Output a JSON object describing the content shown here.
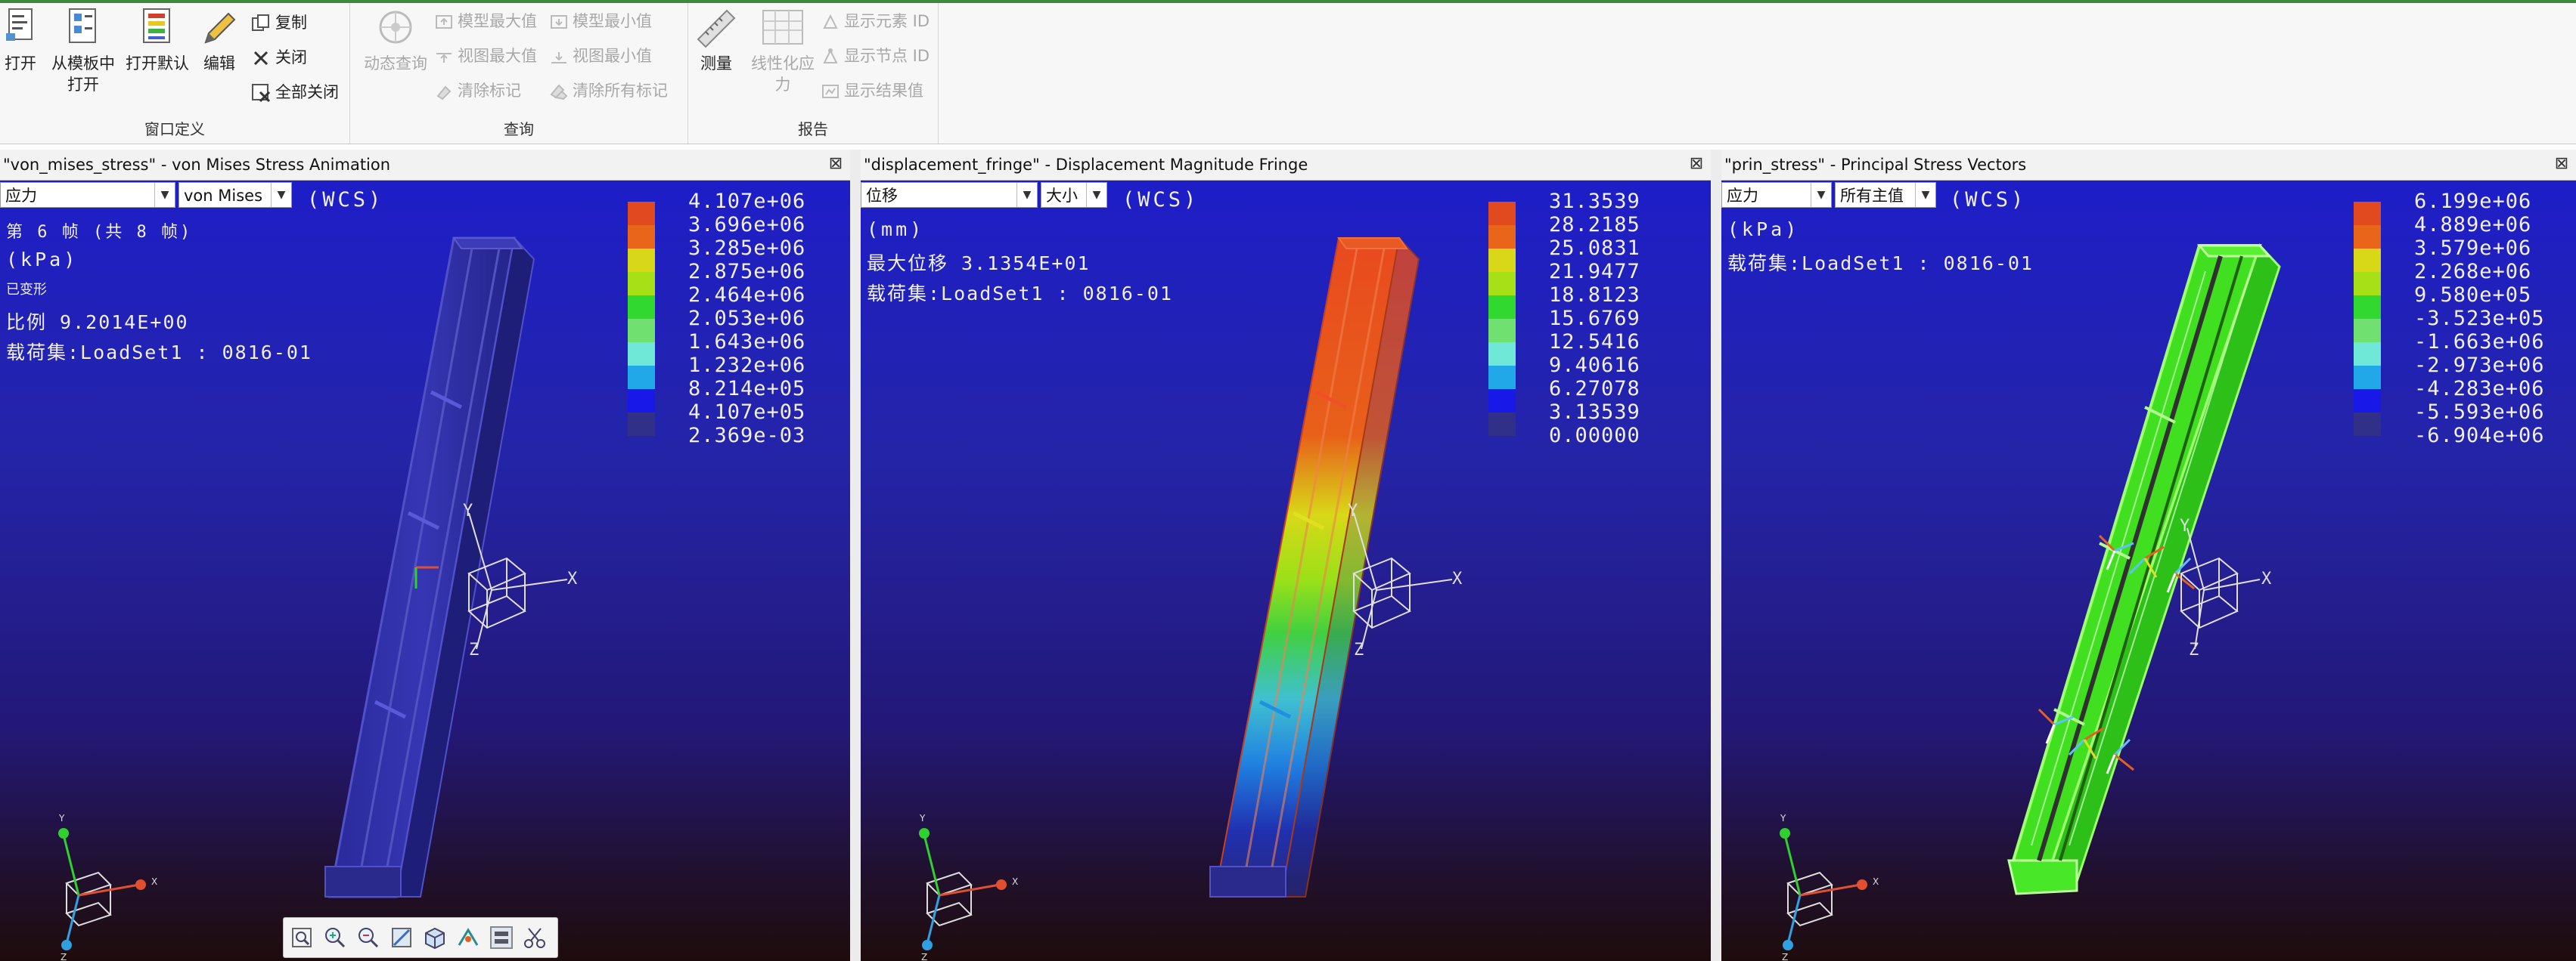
{
  "ribbon": {
    "groups": [
      {
        "label": "窗口定义",
        "buttons": [
          {
            "label_lines": [
              "打开"
            ],
            "icon": "open-file-icon"
          },
          {
            "label_lines": [
              "从模板中",
              "打开"
            ],
            "icon": "open-template-icon"
          },
          {
            "label_lines": [
              "打开默认"
            ],
            "icon": "open-default-icon"
          },
          {
            "label_lines": [
              "编辑"
            ],
            "icon": "pencil-edit-icon"
          }
        ],
        "small_buttons": [
          {
            "label": "复制",
            "icon": "copy-icon"
          },
          {
            "label": "关闭",
            "icon": "close-x-icon"
          },
          {
            "label": "全部关闭",
            "icon": "close-all-icon"
          }
        ]
      },
      {
        "label": "查询",
        "buttons": [
          {
            "label_lines": [
              "动态查询"
            ],
            "icon": "dynamic-query-icon"
          }
        ],
        "small_buttons": [
          {
            "label": "模型最大值",
            "icon": "model-max-icon"
          },
          {
            "label": "视图最大值",
            "icon": "view-max-icon"
          },
          {
            "label": "清除标记",
            "icon": "clear-marker-icon"
          },
          {
            "label": "模型最小值",
            "icon": "model-min-icon"
          },
          {
            "label": "视图最小值",
            "icon": "view-min-icon"
          },
          {
            "label": "清除所有标记",
            "icon": "clear-all-markers-icon"
          }
        ]
      },
      {
        "label": "报告",
        "buttons": [
          {
            "label_lines": [
              "测量"
            ],
            "icon": "measure-ruler-icon"
          },
          {
            "label_lines": [
              "线性化应",
              "力"
            ],
            "icon": "linearize-stress-icon"
          }
        ],
        "small_buttons": [
          {
            "label": "显示元素 ID",
            "icon": "element-id-icon"
          },
          {
            "label": "显示节点 ID",
            "icon": "node-id-icon"
          },
          {
            "label": "显示结果值",
            "icon": "result-value-icon"
          }
        ]
      }
    ]
  },
  "panes": [
    {
      "title": "\"von_mises_stress\" - von Mises Stress Animation",
      "select1": "应力",
      "select2": "von Mises",
      "wcs": "(WCS)",
      "info": [
        "第 6 帧 (共 8 帧)",
        "(kPa)",
        "已变形",
        "比例  9.2014E+00",
        "载荷集:LoadSet1 : 0816-01"
      ],
      "legend_colors": [
        "#e04a1e",
        "#e8651a",
        "#d8d818",
        "#a8e018",
        "#30d830",
        "#70e070",
        "#70e8d8",
        "#20a8e8",
        "#1818e8",
        "#303088"
      ],
      "legend_values": [
        "4.107e+06",
        "3.696e+06",
        "3.285e+06",
        "2.875e+06",
        "2.464e+06",
        "2.053e+06",
        "1.643e+06",
        "1.232e+06",
        "8.214e+05",
        "4.107e+05",
        "2.369e-03"
      ],
      "model": "blue"
    },
    {
      "title": "\"displacement_fringe\" - Displacement Magnitude Fringe",
      "select1": "位移",
      "select2": "大小",
      "wcs": "(WCS)",
      "info": [
        "(mm)",
        "最大位移  3.1354E+01",
        "载荷集:LoadSet1 : 0816-01"
      ],
      "legend_colors": [
        "#e04a1e",
        "#e8651a",
        "#d8d818",
        "#a8e018",
        "#30d830",
        "#70e070",
        "#70e8d8",
        "#20a8e8",
        "#1818e8",
        "#303088"
      ],
      "legend_values": [
        "31.3539",
        "28.2185",
        "25.0831",
        "21.9477",
        "18.8123",
        "15.6769",
        "12.5416",
        "9.40616",
        "6.27078",
        "3.13539",
        "0.00000"
      ],
      "model": "fringe"
    },
    {
      "title": "\"prin_stress\" - Principal Stress Vectors",
      "select1": "应力",
      "select2": "所有主值",
      "wcs": "(WCS)",
      "info": [
        "(kPa)",
        "载荷集:LoadSet1 : 0816-01"
      ],
      "legend_colors": [
        "#e04a1e",
        "#e8651a",
        "#d8d818",
        "#a8e018",
        "#30d830",
        "#70e070",
        "#70e8d8",
        "#20a8e8",
        "#1818e8",
        "#303088"
      ],
      "legend_values": [
        "6.199e+06",
        "4.889e+06",
        "3.579e+06",
        "2.268e+06",
        "9.580e+05",
        "-3.523e+05",
        "-1.663e+06",
        "-2.973e+06",
        "-4.283e+06",
        "-5.593e+06",
        "-6.904e+06"
      ],
      "model": "green"
    }
  ],
  "axes": {
    "x": "X",
    "y": "Y",
    "z": "Z"
  },
  "view_toolbar": [
    "refit-icon",
    "zoom-in-icon",
    "zoom-out-icon",
    "repaint-icon",
    "saved-views-icon",
    "spin-center-icon",
    "view-mode-icon",
    "cut-view-icon"
  ]
}
